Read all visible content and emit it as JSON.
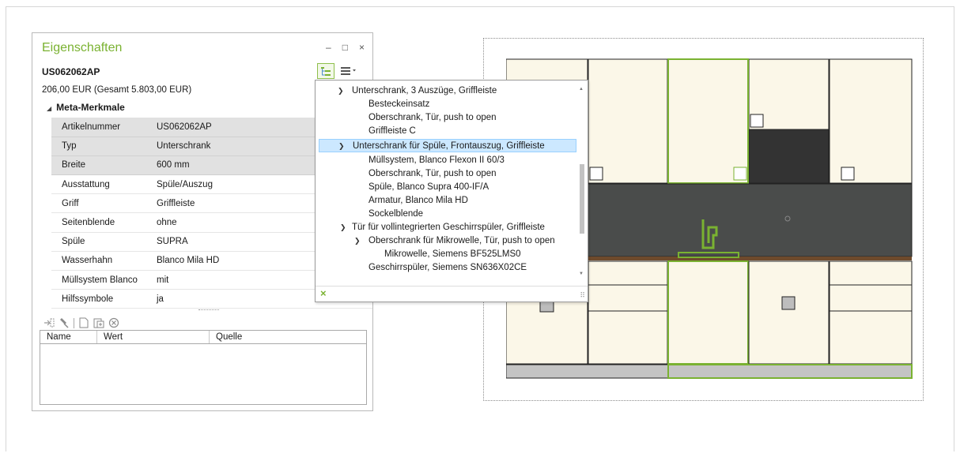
{
  "panel": {
    "title": "Eigenschaften",
    "window_buttons": {
      "minimize": "–",
      "maximize": "□",
      "close": "×"
    },
    "article_id": "US062062AP",
    "price": "206,00 EUR (Gesamt 5.803,00 EUR)",
    "meta_section": "Meta-Merkmale",
    "properties": [
      {
        "key": "Artikelnummer",
        "value": "US062062AP",
        "shaded": true
      },
      {
        "key": "Typ",
        "value": "Unterschrank",
        "shaded": true
      },
      {
        "key": "Breite",
        "value": "600 mm",
        "shaded": true
      },
      {
        "key": "Ausstattung",
        "value": "Spüle/Auszug",
        "shaded": false
      },
      {
        "key": "Griff",
        "value": "Griffleiste",
        "shaded": false
      },
      {
        "key": "Seitenblende",
        "value": "ohne",
        "shaded": false
      },
      {
        "key": "Spüle",
        "value": "SUPRA",
        "shaded": false
      },
      {
        "key": "Wasserhahn",
        "value": "Blanco Mila HD",
        "shaded": false
      },
      {
        "key": "Müllsystem Blanco",
        "value": "mit",
        "shaded": false
      },
      {
        "key": "Hilfssymbole",
        "value": "ja",
        "shaded": false
      }
    ],
    "grid_columns": [
      "Name",
      "Wert",
      "Quelle"
    ]
  },
  "dropdown": {
    "items": [
      {
        "text": "Unterschrank, 3 Auszüge, Griffleiste",
        "level": 1,
        "expanded": true,
        "selected": false
      },
      {
        "text": "Besteckeinsatz",
        "level": 2,
        "selected": false
      },
      {
        "text": "Oberschrank, Tür, push to open",
        "level": 2,
        "selected": false
      },
      {
        "text": "Griffleiste C",
        "level": 2,
        "selected": false
      },
      {
        "text": "Unterschrank für Spüle, Frontauszug, Griffleiste",
        "level": 1,
        "expanded": true,
        "selected": true
      },
      {
        "text": "Müllsystem, Blanco Flexon II 60/3",
        "level": 2,
        "selected": false
      },
      {
        "text": "Oberschrank, Tür, push to open",
        "level": 2,
        "selected": false
      },
      {
        "text": "Spüle, Blanco Supra 400-IF/A",
        "level": 2,
        "selected": false
      },
      {
        "text": "Armatur, Blanco Mila HD",
        "level": 2,
        "selected": false
      },
      {
        "text": "Sockelblende",
        "level": 2,
        "selected": false
      },
      {
        "text": "Tür für vollintegrierten Geschirrspüler, Griffleiste",
        "level": 1,
        "expanded": false,
        "selected": false
      },
      {
        "text": "Oberschrank für Mikrowelle, Tür, push to open",
        "level": 2,
        "expanded": true,
        "selected": false
      },
      {
        "text": "Mikrowelle, Siemens BF525LMS0",
        "level": 3,
        "selected": false
      },
      {
        "text": "Geschirrspüler, Siemens SN636X02CE",
        "level": 2,
        "selected": false
      }
    ],
    "close_label": "×"
  },
  "colors": {
    "accent": "#7ab231",
    "selection": "#cce8ff",
    "cabinet_front": "#fbf7e8",
    "dark_panel": "#333333",
    "backsplash": "#4a4c4b",
    "worktop": "#6e4a2c",
    "plinth": "#c4c4c4"
  },
  "icons": {
    "tree_view": "tree-view-icon",
    "menu": "menu-dropdown-icon",
    "move_out": "move-out-icon",
    "pin": "pin-icon",
    "new_doc": "new-document-icon",
    "paste": "paste-icon",
    "cancel": "cancel-circle-icon"
  }
}
